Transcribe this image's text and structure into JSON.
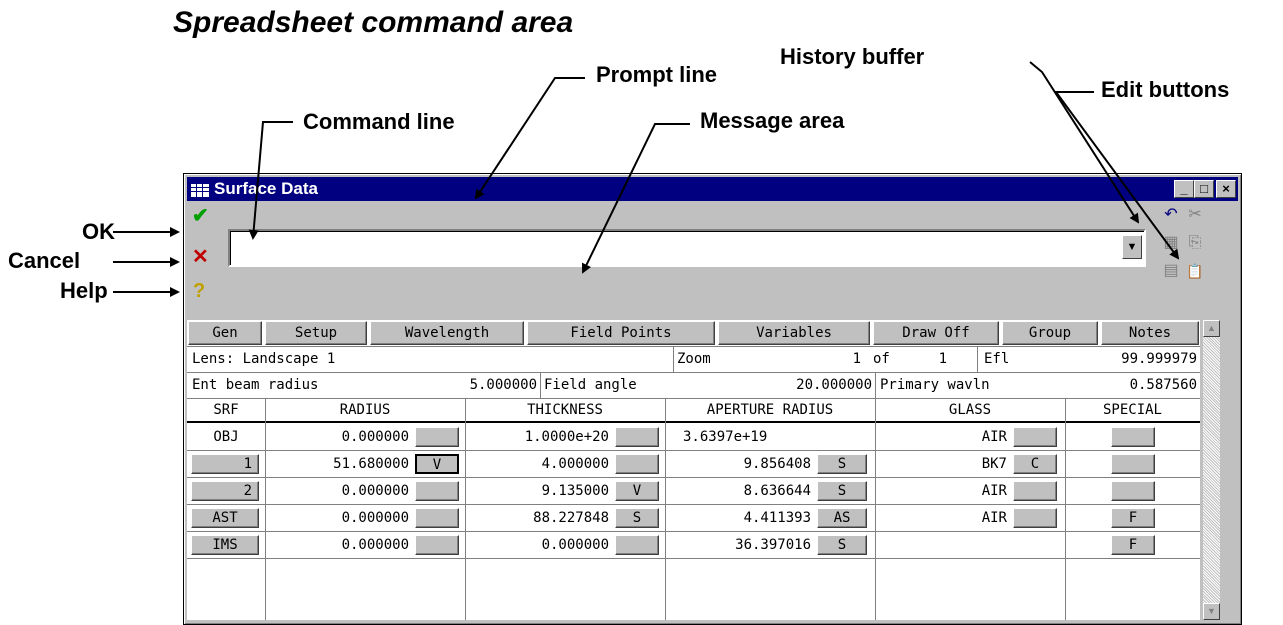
{
  "annotations": {
    "title": "Spreadsheet command area",
    "prompt_line": "Prompt line",
    "history_buffer": "History buffer",
    "edit_buttons": "Edit buttons",
    "command_line": "Command line",
    "message_area": "Message area",
    "ok": "OK",
    "cancel": "Cancel",
    "help": "Help"
  },
  "window": {
    "title": "Surface Data",
    "buttons": {
      "minimize": "_",
      "maximize": "□",
      "close": "×"
    }
  },
  "command": {
    "ok_icon": "✔",
    "cancel_icon": "✕",
    "help_icon": "?",
    "input_value": "",
    "dropdown_icon": "▼",
    "edit_icons": [
      "history-icon",
      "cut-icon",
      "grid-icon",
      "copy-icon",
      "grid2-icon",
      "paste-icon"
    ],
    "edit_glyphs": [
      "↶",
      "✂",
      "▦",
      "⎘",
      "▤",
      "📋"
    ]
  },
  "tabs": [
    "Gen",
    "Setup",
    "Wavelength",
    "Field Points",
    "Variables",
    "Draw Off",
    "Group",
    "Notes"
  ],
  "info": {
    "lens_label": "Lens: Landscape 1",
    "zoom_label": "Zoom",
    "zoom_value": "1",
    "zoom_of": "of",
    "zoom_total": "1",
    "efl_label": "Efl",
    "efl_value": "99.999979",
    "ent_label": "Ent beam radius",
    "ent_value": "5.000000",
    "field_label": "Field angle",
    "field_value": "20.000000",
    "wavln_label": "Primary wavln",
    "wavln_value": "0.587560"
  },
  "columns": [
    "SRF",
    "RADIUS",
    "THICKNESS",
    "APERTURE RADIUS",
    "GLASS",
    "SPECIAL"
  ],
  "rows": [
    {
      "srf": "OBJ",
      "srf_btn": false,
      "radius": "0.000000",
      "radius_btn": "",
      "thickness": "1.0000e+20",
      "thick_btn": "",
      "aperture": "3.6397e+19",
      "ap_btn": null,
      "glass": "AIR",
      "glass_btn": "",
      "special": ""
    },
    {
      "srf": "1",
      "srf_btn": true,
      "radius": "51.680000",
      "radius_btn": "V",
      "thickness": "4.000000",
      "thick_btn": "",
      "aperture": "9.856408",
      "ap_btn": "S",
      "glass": "BK7",
      "glass_btn": "C",
      "special": ""
    },
    {
      "srf": "2",
      "srf_btn": true,
      "radius": "0.000000",
      "radius_btn": "",
      "thickness": "9.135000",
      "thick_btn": "V",
      "aperture": "8.636644",
      "ap_btn": "S",
      "glass": "AIR",
      "glass_btn": "",
      "special": ""
    },
    {
      "srf": "AST",
      "srf_btn": true,
      "radius": "0.000000",
      "radius_btn": "",
      "thickness": "88.227848",
      "thick_btn": "S",
      "aperture": "4.411393",
      "ap_btn": "AS",
      "glass": "AIR",
      "glass_btn": "",
      "special": "F"
    },
    {
      "srf": "IMS",
      "srf_btn": true,
      "radius": "0.000000",
      "radius_btn": "",
      "thickness": "0.000000",
      "thick_btn": "",
      "aperture": "36.397016",
      "ap_btn": "S",
      "glass": "",
      "glass_btn": null,
      "special": "F"
    }
  ],
  "scrollbar": {
    "up": "▲",
    "down": "▼"
  }
}
